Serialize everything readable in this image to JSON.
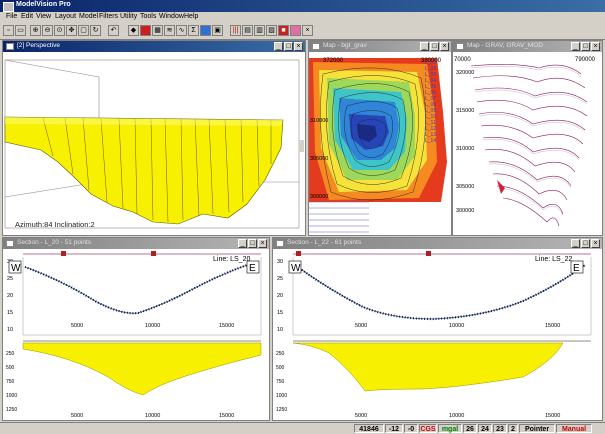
{
  "app": {
    "title": "ModelVision Pro"
  },
  "menu": [
    "File",
    "Edit",
    "View",
    "Layout",
    "Model",
    "Filters",
    "Utility",
    "Tools",
    "Window",
    "Help"
  ],
  "toolbar_icons": [
    "new-icon",
    "open-icon",
    "zoom-in-icon",
    "zoom-out-icon",
    "zoom-fit-icon",
    "pan-icon",
    "select-icon",
    "rotate-icon",
    "undo-icon",
    "model-icon",
    "body-icon",
    "grid-icon",
    "contour-icon",
    "profile-icon",
    "compute-icon",
    "color-icon",
    "map-icon",
    "layers-icon",
    "chart-icon",
    "table-icon",
    "help-icon",
    "close-icon"
  ],
  "windows": {
    "perspective": {
      "title": "[2] Perspective",
      "caption": "Azimuth:84  Inclination:2"
    },
    "map1": {
      "title": "Map - bgt_grav",
      "ticks_x": [
        "372000",
        "380000"
      ],
      "ticks_y": [
        "310000",
        "305000",
        "300000"
      ],
      "line_labels": [
        "L_01",
        "L_02",
        "L_03",
        "L_04",
        "L_05",
        "L_06",
        "L_07",
        "L_08",
        "L_09",
        "L_10",
        "L_11",
        "L_12",
        "L_13",
        "L_14"
      ]
    },
    "map2": {
      "title": "Map - GRAV, GRAV_MOD",
      "ticks_x": [
        "70000",
        "790000"
      ],
      "ticks_y": [
        "320000",
        "315000",
        "310000",
        "305000",
        "300000"
      ]
    },
    "section1": {
      "title": "Section - L_20 - 51 points",
      "line_label": "Line: LS_20",
      "end_w": "W",
      "end_e": "E",
      "y_ticks_top": [
        "30",
        "25",
        "20",
        "15",
        "10"
      ],
      "x_ticks": [
        "5000",
        "10000",
        "15000"
      ],
      "y_ticks_bottom": [
        "250",
        "500",
        "750",
        "1000",
        "1250"
      ]
    },
    "section2": {
      "title": "Section - L_22 - 61 points",
      "line_label": "Line: LS_22",
      "end_w": "W",
      "end_e": "E",
      "y_ticks_top": [
        "30",
        "25",
        "20",
        "15",
        "10"
      ],
      "x_ticks": [
        "5000",
        "10000",
        "15000"
      ],
      "y_ticks_bottom": [
        "250",
        "500",
        "750",
        "1000",
        "1250"
      ]
    }
  },
  "status": {
    "value1": "41846",
    "value2": "-12",
    "value3": "-0",
    "units": "CGS",
    "grav_unit": "mgal",
    "n1": "26",
    "n2": "24",
    "n3": "23",
    "n4": "2",
    "mode": "Pointer",
    "calc": "Manual"
  },
  "colors": {
    "body": "#f7f000",
    "accent": "#0a246a",
    "status_red": "#cc0000",
    "status_green": "#008000"
  }
}
